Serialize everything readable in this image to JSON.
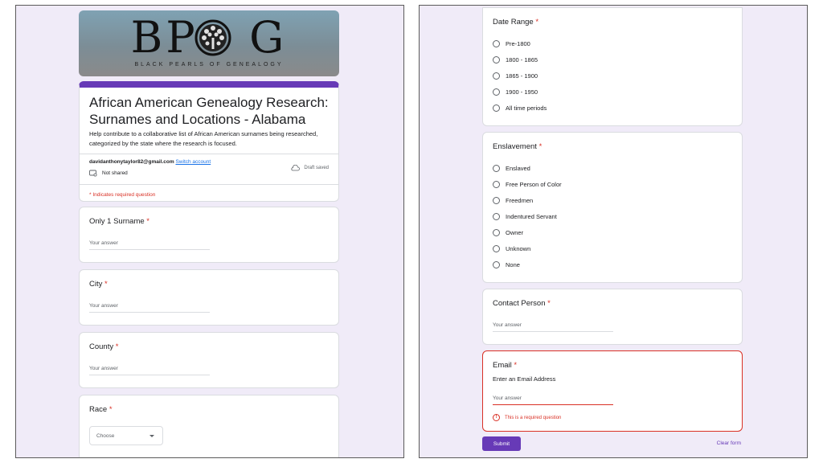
{
  "left": {
    "banner": {
      "logo": "BPOG",
      "tagline": "BLACK PEARLS OF GENEALOGY"
    },
    "header": {
      "title": "African American Genealogy Research: Surnames and Locations - Alabama",
      "description": "Help contribute to a collaborative list of African American surnames being researched, categorized by the state where the research is focused.",
      "account_email": "davidanthonytaylor82@gmail.com",
      "switch_account": "Switch account",
      "not_shared": "Not shared",
      "draft_status": "Draft saved",
      "required_note": "* Indicates required question"
    },
    "questions": [
      {
        "title": "Only 1 Surname",
        "required_mark": "*",
        "placeholder": "Your answer"
      },
      {
        "title": "City",
        "required_mark": "*",
        "placeholder": "Your answer"
      },
      {
        "title": "County",
        "required_mark": "*",
        "placeholder": "Your answer"
      }
    ],
    "race": {
      "title": "Race",
      "required_mark": "*",
      "selected": "Choose"
    }
  },
  "right": {
    "date_range": {
      "title": "Date Range",
      "required_mark": "*",
      "options": [
        "Pre-1800",
        "1800 - 1865",
        "1865 - 1900",
        "1900 - 1950",
        "All time periods"
      ]
    },
    "enslavement": {
      "title": "Enslavement",
      "required_mark": "*",
      "options": [
        "Enslaved",
        "Free Person of Color",
        "Freedmen",
        "Indentured Servant",
        "Owner",
        "Unknown",
        "None"
      ]
    },
    "contact": {
      "title": "Contact Person",
      "required_mark": "*",
      "placeholder": "Your answer"
    },
    "email": {
      "title": "Email",
      "required_mark": "*",
      "description": "Enter an Email Address",
      "placeholder": "Your answer",
      "error": "This is a required question"
    },
    "submit_label": "Submit",
    "clear_label": "Clear form"
  },
  "colors": {
    "accent": "#673ab7",
    "error": "#d93025",
    "background": "#f0ebf8"
  },
  "icons": [
    "tree-logo-icon",
    "not-shared-icon",
    "cloud-saved-icon",
    "error-icon",
    "chevron-down-icon"
  ]
}
